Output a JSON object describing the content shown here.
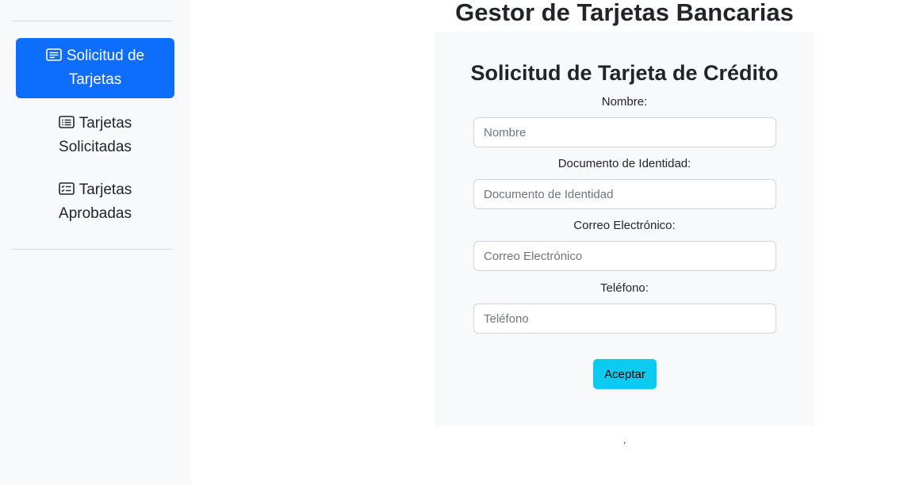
{
  "app": {
    "title": "Gestor de Tarjetas Bancarias"
  },
  "sidebar": {
    "items": [
      {
        "label_line1": "Solicitud de",
        "label_line2": "Tarjetas",
        "icon": "card-text-icon",
        "active": true
      },
      {
        "label_line1": "Tarjetas",
        "label_line2": "Solicitadas",
        "icon": "list-icon",
        "active": false
      },
      {
        "label_line1": "Tarjetas",
        "label_line2": "Aprobadas",
        "icon": "list-check-icon",
        "active": false
      }
    ],
    "active_color": "#0d6efd"
  },
  "form": {
    "title": "Solicitud de Tarjeta de Crédito",
    "fields": [
      {
        "label": "Nombre:",
        "placeholder": "Nombre",
        "value": ""
      },
      {
        "label": "Documento de Identidad:",
        "placeholder": "Documento de Identidad",
        "value": ""
      },
      {
        "label": "Correo Electrónico:",
        "placeholder": "Correo Electrónico",
        "value": ""
      },
      {
        "label": "Teléfono:",
        "placeholder": "Teléfono",
        "value": ""
      }
    ],
    "submit_label": "Aceptar",
    "submit_color": "#0dcaf0"
  },
  "footer": {
    "mark": ","
  }
}
